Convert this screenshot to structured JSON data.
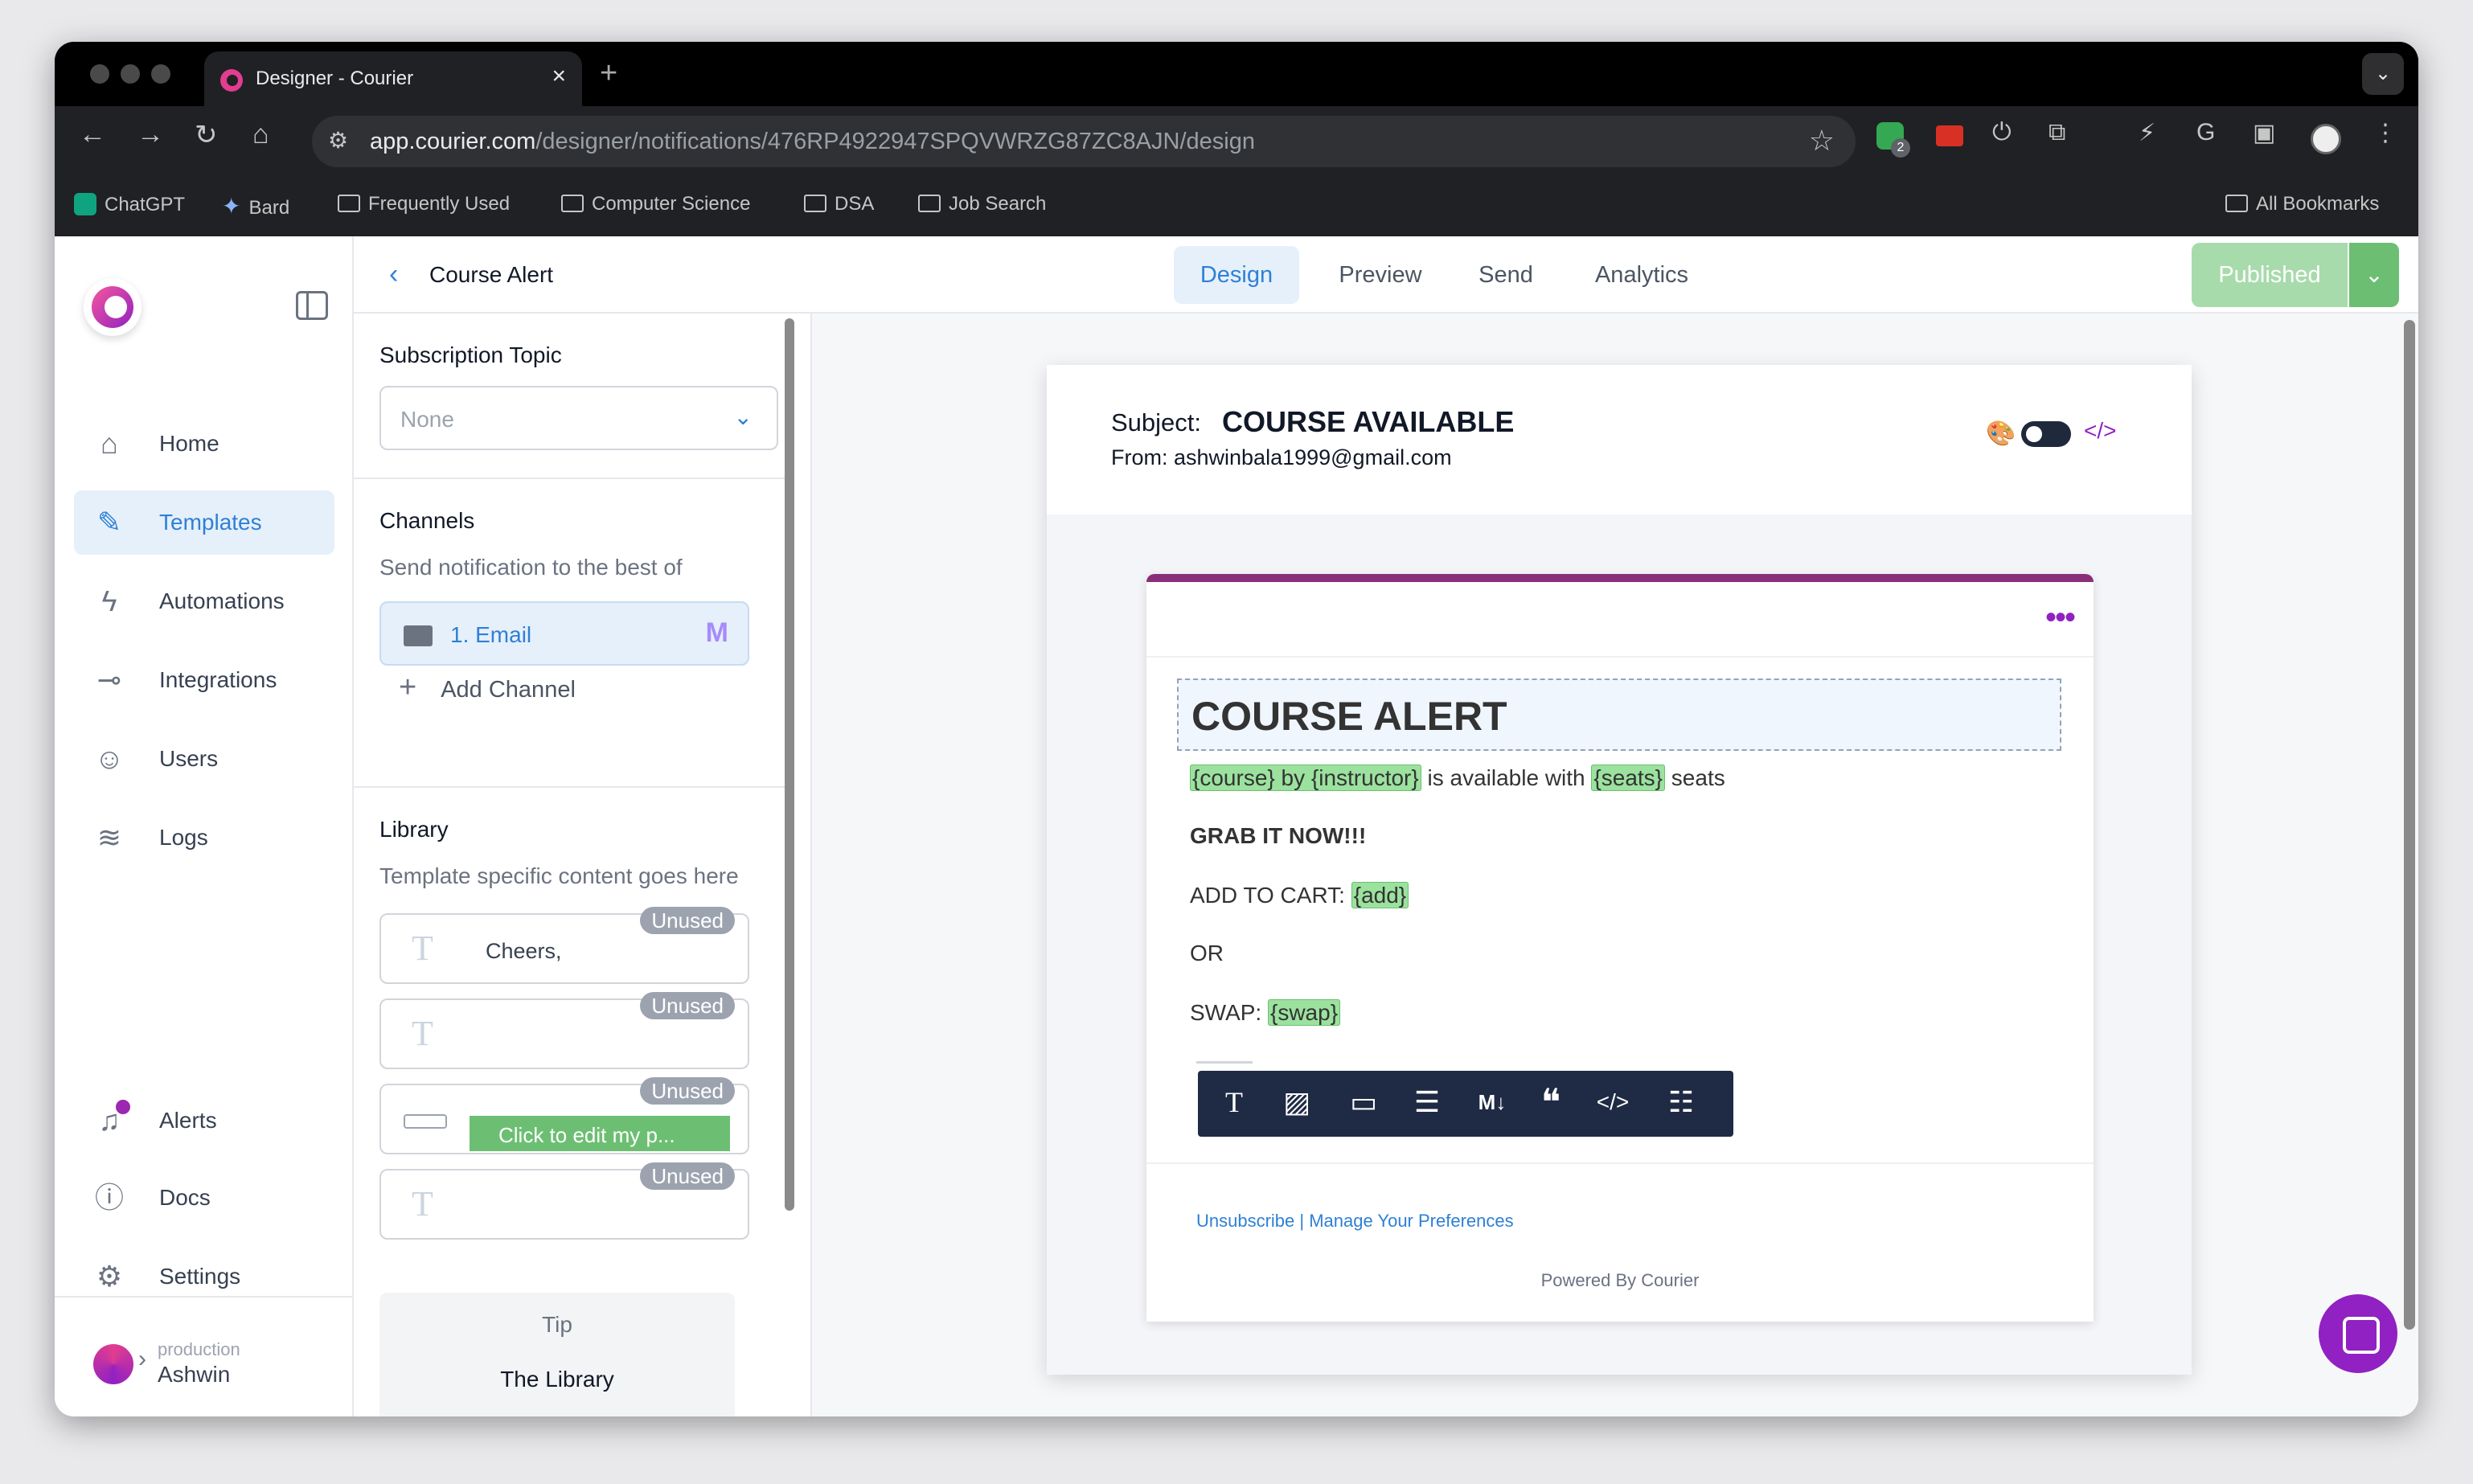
{
  "browser": {
    "tab_title": "Designer - Courier",
    "url_host": "app.courier.com",
    "url_path": "/designer/notifications/476RP4922947SPQVWRZG87ZC8AJN/design",
    "extension_badge": "2",
    "bookmarks": [
      "ChatGPT",
      "Bard",
      "Frequently Used",
      "Computer Science",
      "DSA",
      "Job Search"
    ],
    "all_bookmarks": "All Bookmarks"
  },
  "sidebar": {
    "items": [
      {
        "label": "Home",
        "icon": "home-icon"
      },
      {
        "label": "Templates",
        "icon": "templates-icon",
        "active": true
      },
      {
        "label": "Automations",
        "icon": "bolt-icon"
      },
      {
        "label": "Integrations",
        "icon": "plug-icon"
      },
      {
        "label": "Users",
        "icon": "users-icon"
      },
      {
        "label": "Logs",
        "icon": "layers-icon"
      }
    ],
    "bottom_items": [
      {
        "label": "Alerts",
        "icon": "bell-icon"
      },
      {
        "label": "Docs",
        "icon": "info-icon"
      },
      {
        "label": "Settings",
        "icon": "gear-icon"
      }
    ],
    "environment": "production",
    "workspace": "Ashwin"
  },
  "header": {
    "title": "Course Alert",
    "tabs": [
      "Design",
      "Preview",
      "Send",
      "Analytics"
    ],
    "active_tab": "Design",
    "publish_label": "Published"
  },
  "panel": {
    "subscription_title": "Subscription Topic",
    "subscription_value": "None",
    "channels_title": "Channels",
    "channels_sub": "Send notification to the best of",
    "channel_item": "1.  Email",
    "add_channel": "Add Channel",
    "library_title": "Library",
    "library_sub": "Template specific content goes here",
    "library_items": [
      {
        "badge": "Unused",
        "text": "Cheers,"
      },
      {
        "badge": "Unused",
        "text": ""
      },
      {
        "badge": "Unused",
        "text": "Click to edit my p..."
      },
      {
        "badge": "Unused",
        "text": ""
      }
    ],
    "tip_label": "Tip",
    "tip_title": "The Library"
  },
  "email": {
    "subject_label": "Subject:",
    "subject": "COURSE AVAILABLE",
    "from": "From: ashwinbala1999@gmail.com",
    "heading": "COURSE ALERT",
    "line1": {
      "var1": "{course} by {instructor}",
      "mid": " is available with ",
      "var2": "{seats}",
      "end": " seats"
    },
    "line2": "GRAB IT NOW!!!",
    "line3": {
      "text": "ADD TO CART: ",
      "var": "{add}"
    },
    "line4": "OR",
    "line5": {
      "text": "SWAP: ",
      "var": "{swap}"
    },
    "unsubscribe": "Unsubscribe | Manage Your Preferences",
    "powered_by": "Powered By Courier"
  },
  "toolbar_icons": [
    "text-icon",
    "image-icon",
    "button-icon",
    "divider-icon",
    "markdown-icon",
    "quote-icon",
    "code-icon",
    "list-icon"
  ]
}
